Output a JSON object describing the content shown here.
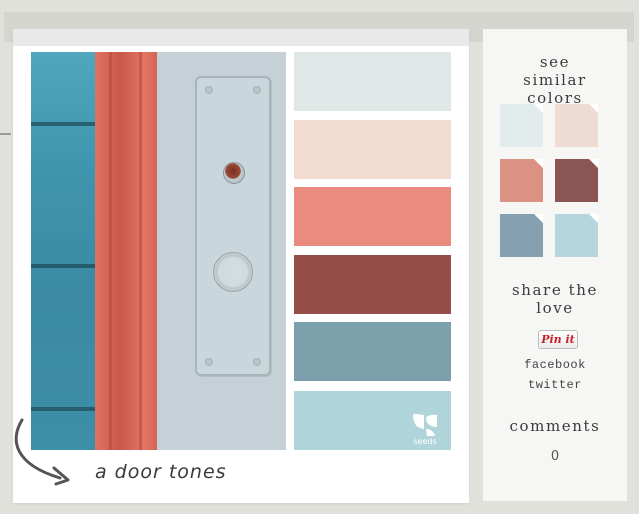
{
  "palette": {
    "title": "a door tones",
    "brand": "seeds",
    "swatch_colors": [
      "#dfe8e6",
      "#f2dccf",
      "#e98b7e",
      "#954e48",
      "#7ca0ab",
      "#afd5da"
    ]
  },
  "sidebar": {
    "similar_heading": "see similar colors",
    "similar_colors": [
      "#e3ecec",
      "#eedcd3",
      "#d99283",
      "#8b5553",
      "#84a0b1",
      "#b6d5dc"
    ],
    "share_heading": "share the love",
    "pinit_label": "Pin it",
    "facebook_label": "facebook",
    "twitter_label": "twitter",
    "comments_heading": "comments",
    "comments_count": "0"
  }
}
